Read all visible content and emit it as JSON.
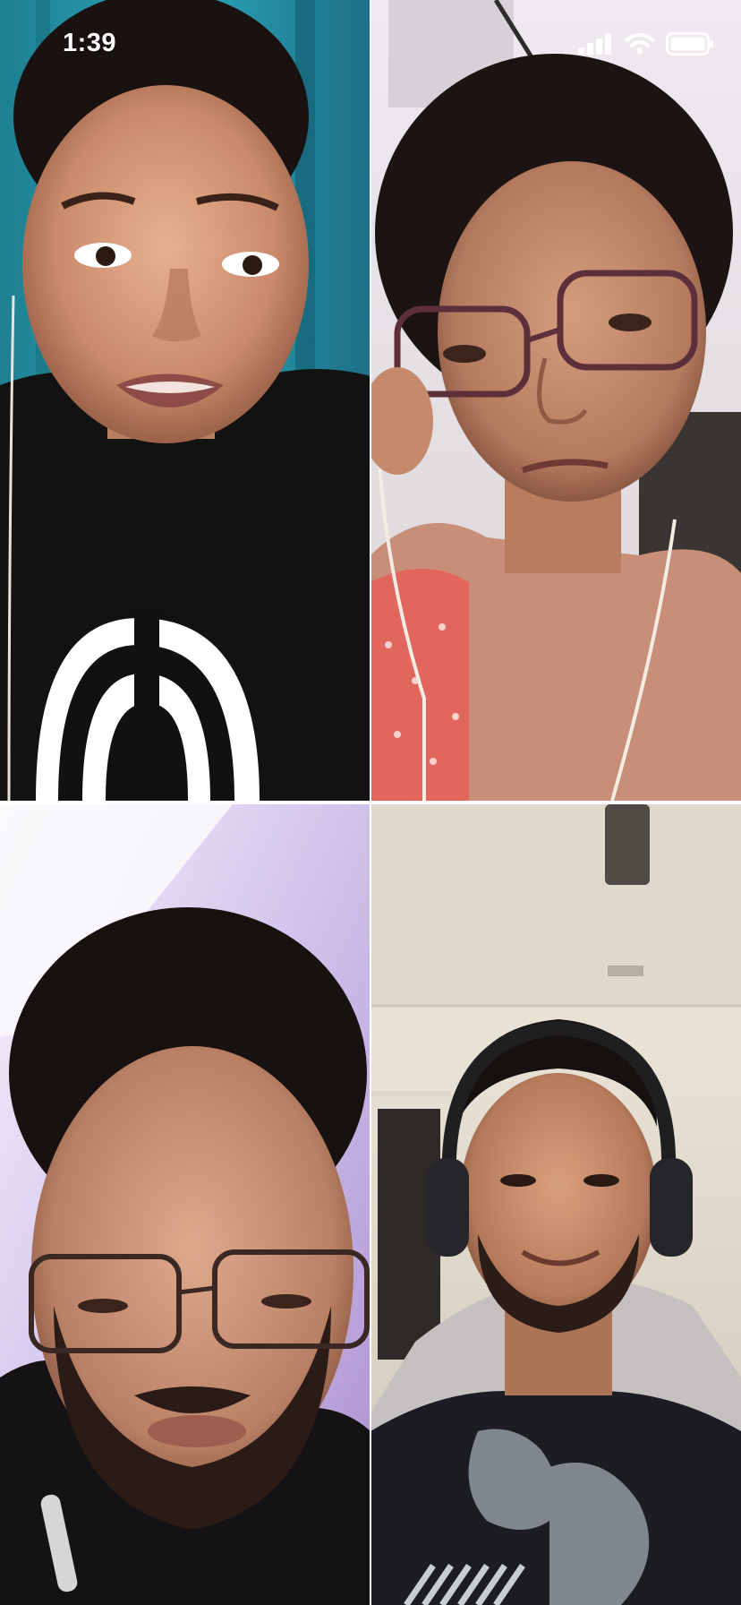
{
  "status_bar": {
    "time": "1:39",
    "signal_icon": "cellular-signal-icon",
    "wifi_icon": "wifi-icon",
    "battery_icon": "battery-icon"
  },
  "video_grid": {
    "participants": [
      {
        "tile": "top-left"
      },
      {
        "tile": "top-right"
      },
      {
        "tile": "bottom-left"
      },
      {
        "tile": "bottom-right"
      }
    ]
  },
  "colors": {
    "status_text": "#ffffff",
    "tile_divider": "#ffffff"
  }
}
